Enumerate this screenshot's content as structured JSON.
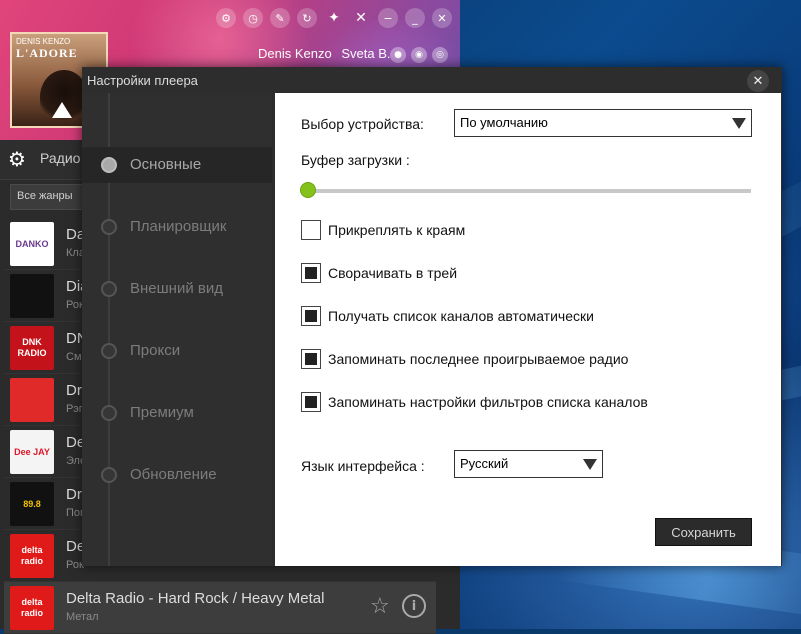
{
  "player": {
    "now_playing": {
      "artist": "DENIS KENZO",
      "song": "L'ADORE"
    },
    "users": [
      "Denis Kenzo",
      "Sveta B."
    ],
    "toolbar_icons": [
      "settings-icon",
      "clock-icon",
      "pencil-icon",
      "refresh-icon",
      "wrench-icon",
      "pin-icon",
      "minimize-icon",
      "collapse-icon",
      "close-icon"
    ],
    "radio_label": "Радио",
    "genre_filter": "Все жанры",
    "stations": [
      {
        "name": "Da",
        "genre": "Кла",
        "logo_text": "DANKO",
        "logo_bg": "#ffffff",
        "logo_fg": "#6a3a8c"
      },
      {
        "name": "Dia",
        "genre": "Рок",
        "logo_text": "",
        "logo_bg": "#111111",
        "logo_fg": "#ffffff"
      },
      {
        "name": "DN",
        "genre": "Сме",
        "logo_text": "DNK RADIO",
        "logo_bg": "#c4121a",
        "logo_fg": "#ffffff"
      },
      {
        "name": "Dr",
        "genre": "Рэп",
        "logo_text": "",
        "logo_bg": "#e02a2a",
        "logo_fg": "#ffffff"
      },
      {
        "name": "De",
        "genre": "Эле",
        "logo_text": "Dee JAY",
        "logo_bg": "#f4f4f4",
        "logo_fg": "#e0162b"
      },
      {
        "name": "Dr",
        "genre": "Поп",
        "logo_text": "89.8",
        "logo_bg": "#111111",
        "logo_fg": "#f2c200"
      },
      {
        "name": "De",
        "genre": "Рок",
        "logo_text": "delta radio",
        "logo_bg": "#e01919",
        "logo_fg": "#ffffff"
      },
      {
        "name": "Delta Radio - Hard Rock / Heavy Metal",
        "genre": "Метал",
        "logo_text": "delta radio",
        "logo_bg": "#e01919",
        "logo_fg": "#ffffff",
        "selected": true
      }
    ]
  },
  "dialog": {
    "title": "Настройки плеера",
    "nav": [
      {
        "label": "Основные",
        "active": true
      },
      {
        "label": "Планировщик"
      },
      {
        "label": "Внешний вид"
      },
      {
        "label": "Прокси"
      },
      {
        "label": "Премиум"
      },
      {
        "label": "Обновление"
      }
    ],
    "device_label": "Выбор устройства:",
    "device_value": "По умолчанию",
    "buffer_label": "Буфер загрузки :",
    "buffer_level": 0.0,
    "checkboxes": [
      {
        "label": "Прикреплять к краям",
        "checked": false
      },
      {
        "label": "Сворачивать в трей",
        "checked": true
      },
      {
        "label": "Получать список каналов автоматически",
        "checked": true
      },
      {
        "label": "Запоминать последнее проигрываемое радио",
        "checked": true
      },
      {
        "label": "Запоминать настройки фильтров списка каналов",
        "checked": true
      }
    ],
    "language_label": "Язык интерфейса :",
    "language_value": "Русский",
    "save_label": "Сохранить"
  },
  "colors": {
    "accent": "#84c21b",
    "dialog_bg": "#2d2d2d",
    "content_bg": "#ffffff"
  }
}
